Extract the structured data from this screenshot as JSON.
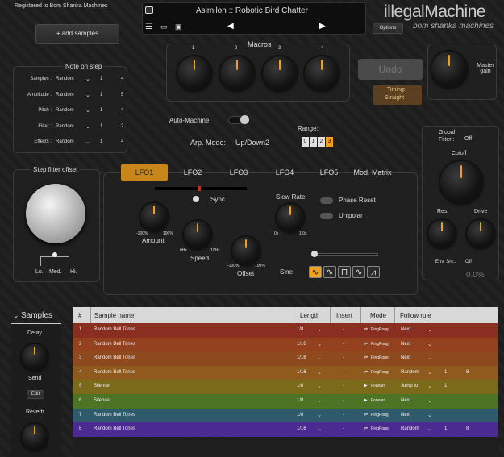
{
  "header": {
    "registered": "Registered to Bom Shanka Machines",
    "add_samples": "+ add samples",
    "preset_name": "Asimilon :: Robotic Bird Chatter",
    "prev": "◀",
    "next": "▶",
    "options": "Options",
    "brand": "illegalMachine",
    "brand_sub": "bom shanka machines"
  },
  "note_on_step": {
    "title": "Note on step",
    "rows": [
      {
        "label": "Samples :",
        "mode": "Random",
        "a": "1",
        "b": "4"
      },
      {
        "label": "Amplitude :",
        "mode": "Random",
        "a": "1",
        "b": "5"
      },
      {
        "label": "Pitch :",
        "mode": "Random",
        "a": "1",
        "b": "4"
      },
      {
        "label": "Filter :",
        "mode": "Random",
        "a": "1",
        "b": "2"
      },
      {
        "label": "Effects :",
        "mode": "Random",
        "a": "1",
        "b": "4"
      }
    ]
  },
  "macros": {
    "title": "Macros",
    "labels": [
      "1",
      "2",
      "3",
      "4"
    ]
  },
  "undo": "Undo",
  "timing": {
    "label": "Timing:",
    "value": "Straight"
  },
  "master_gain": "Master gain",
  "auto_machine": "Auto-Machine",
  "range": {
    "label": "Range:",
    "options": [
      "0",
      "1",
      "2",
      "3"
    ],
    "selected": "3"
  },
  "arp_mode": {
    "label": "Arp. Mode:",
    "value": "Up/Down2"
  },
  "global_filter": {
    "label": "Global Filter :",
    "value": "Off",
    "cutoff": "Cutoff",
    "res": "Res.",
    "drive": "Drive",
    "env_src": "Env. Src.:",
    "env_value": "Off",
    "value_readout": "0.0%"
  },
  "step_filter": {
    "title": "Step filter offset",
    "lo": "Lo.",
    "med": "Med.",
    "hi": "Hi."
  },
  "lfo": {
    "tabs": [
      "LFO1",
      "LFO2",
      "LFO3",
      "LFO4",
      "LFO5",
      "Mod. Matrix"
    ],
    "sync": "Sync",
    "slew_rate": "Slew Rate",
    "phase_reset": "Phase Reset",
    "unipolar": "Unipolar",
    "amount": "Amount",
    "amount_min": "-100%",
    "amount_max": "100%",
    "speed": "Speed",
    "speed_min": "0Hz",
    "speed_max": "10Hz",
    "offset": "Offset",
    "offset_min": "-100%",
    "offset_max": "100%",
    "slew_min": "0s",
    "slew_max": "1.0s",
    "shape": "Sine"
  },
  "samples_panel": {
    "title": "Samples",
    "delay": "Delay",
    "send": "Send",
    "edit": "Edit",
    "reverb": "Reverb"
  },
  "table": {
    "headers": [
      "#",
      "Sample name",
      "Length",
      "Insert",
      "Mode",
      "Follow rule"
    ],
    "rows": [
      {
        "n": "1",
        "name": "Random Bell Tones",
        "len": "1/8",
        "ins": "-",
        "mode": "PingPong",
        "rule": "Next",
        "a": "",
        "b": "",
        "color": "#8a2e22"
      },
      {
        "n": "2",
        "name": "Random Bell Tones",
        "len": "1/16",
        "ins": "-",
        "mode": "PingPong",
        "rule": "Next",
        "a": "",
        "b": "",
        "color": "#94411f"
      },
      {
        "n": "3",
        "name": "Random Bell Tones",
        "len": "1/16",
        "ins": "-",
        "mode": "PingPong",
        "rule": "Next",
        "a": "",
        "b": "",
        "color": "#8e4a1e"
      },
      {
        "n": "4",
        "name": "Random Bell Tones",
        "len": "1/16",
        "ins": "-",
        "mode": "PingPong",
        "rule": "Random",
        "a": "1",
        "b": "8",
        "color": "#8f5a1e"
      },
      {
        "n": "5",
        "name": "Silence",
        "len": "1/8",
        "ins": "-",
        "mode": "Forward",
        "rule": "Jump to",
        "a": "1",
        "b": "",
        "color": "#7a6a1a"
      },
      {
        "n": "6",
        "name": "Silence",
        "len": "1/8",
        "ins": "-",
        "mode": "Forward",
        "rule": "Next",
        "a": "",
        "b": "",
        "color": "#4d7425"
      },
      {
        "n": "7",
        "name": "Random Bell Tones",
        "len": "1/8",
        "ins": "-",
        "mode": "PingPong",
        "rule": "Next",
        "a": "",
        "b": "",
        "color": "#2e5a6c"
      },
      {
        "n": "8",
        "name": "Random Bell Tones",
        "len": "1/16",
        "ins": "-",
        "mode": "PingPong",
        "rule": "Random",
        "a": "1",
        "b": "8",
        "color": "#4b2a92"
      }
    ]
  },
  "colors": {
    "accent": "#f0a020",
    "lfo_active": "#c8861a"
  }
}
